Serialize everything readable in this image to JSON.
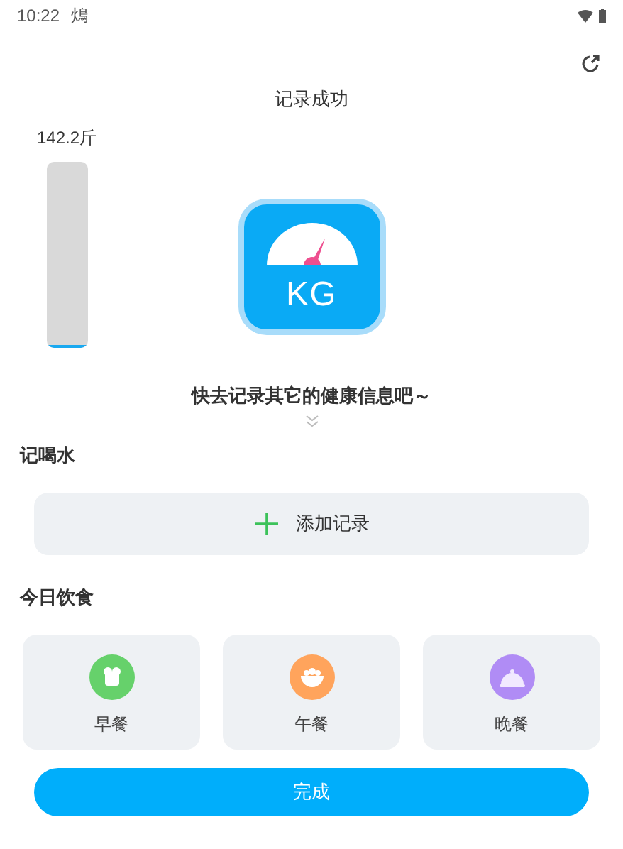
{
  "status_bar": {
    "time": "10:22",
    "app_glyph": "熓"
  },
  "title": "记录成功",
  "gauge": {
    "reading": "142.2斤",
    "level": 0.01
  },
  "scale_icon": {
    "unit": "KG"
  },
  "prompt": "快去记录其它的健康信息吧～",
  "water": {
    "heading": "记喝水",
    "add_button": "添加记录"
  },
  "meals": {
    "heading": "今日饮食",
    "items": [
      {
        "label": "早餐",
        "kind": "bread",
        "color": "#66d16b"
      },
      {
        "label": "午餐",
        "kind": "bowl",
        "color": "#ffa45c"
      },
      {
        "label": "晚餐",
        "kind": "cloche",
        "color": "#b08cf5"
      }
    ]
  },
  "done_button": "完成"
}
